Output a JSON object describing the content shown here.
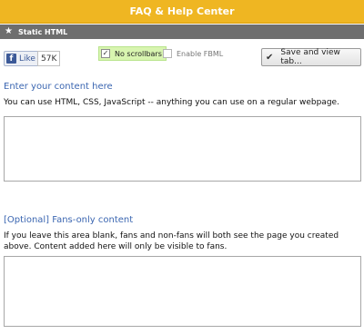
{
  "header": {
    "title": "FAQ & Help Center"
  },
  "app_bar": {
    "icon": "star-icon",
    "title": "Static HTML"
  },
  "toolbar": {
    "like_label": "Like",
    "like_count": "57K",
    "no_scrollbars_label": "No scrollbars",
    "no_scrollbars_checked": true,
    "enable_fbml_label": "Enable FBML",
    "enable_fbml_checked": false,
    "save_label": "Save and view tab..."
  },
  "content_section": {
    "title": "Enter your content here",
    "description": "You can use HTML, CSS, JavaScript -- anything you can use on a regular webpage.",
    "value": ""
  },
  "fans_section": {
    "title": "[Optional] Fans-only content",
    "description": "If you leave this area blank, fans and non-fans will both see the page you created above. Content added here will only be visible to fans.",
    "value": ""
  },
  "colors": {
    "header_bg": "#efb622",
    "app_bar_bg": "#6e6e6e",
    "section_title": "#3b66b1",
    "no_scrollbars_bg": "#d8f5b0"
  }
}
